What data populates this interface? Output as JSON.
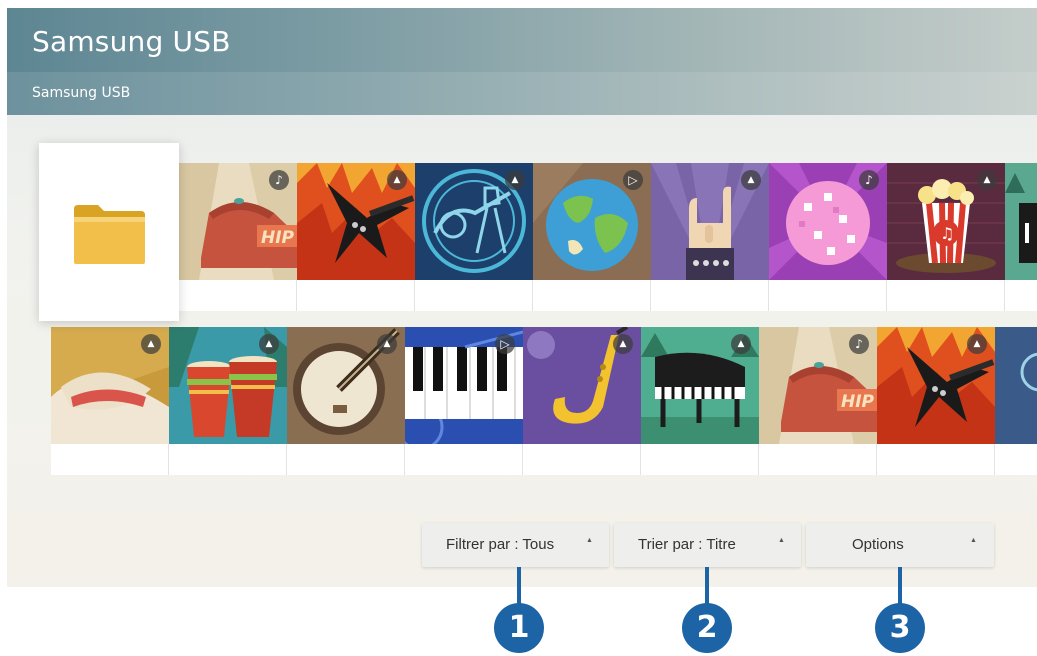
{
  "header": {
    "title": "Samsung USB",
    "breadcrumb": "Samsung USB"
  },
  "folder_tile": {
    "icon": "folder-icon"
  },
  "content_rows": [
    [
      {
        "art": "hip-hop-cap",
        "type": "music"
      },
      {
        "art": "electric-guitar-fire",
        "type": "photo"
      },
      {
        "art": "guitarist-circle",
        "type": "photo"
      },
      {
        "art": "globe",
        "type": "video"
      },
      {
        "art": "rock-hand",
        "type": "photo"
      },
      {
        "art": "disco-ball",
        "type": "music"
      },
      {
        "art": "popcorn",
        "type": "photo"
      },
      {
        "art": "piano-partial",
        "type": "none"
      }
    ],
    [
      {
        "art": "cowboy-hat",
        "type": "photo"
      },
      {
        "art": "bongo-drums",
        "type": "photo"
      },
      {
        "art": "banjo",
        "type": "photo"
      },
      {
        "art": "piano-keys",
        "type": "video"
      },
      {
        "art": "saxophone",
        "type": "photo"
      },
      {
        "art": "grand-piano",
        "type": "photo"
      },
      {
        "art": "hip-hop-cap",
        "type": "music"
      },
      {
        "art": "electric-guitar-fire",
        "type": "photo"
      },
      {
        "art": "partial-circle",
        "type": "none"
      }
    ]
  ],
  "type_badges": {
    "music": "♪",
    "photo": "▲",
    "video": "▷"
  },
  "controls": {
    "filter": {
      "label": "Filtrer par : Tous",
      "caret": "▲"
    },
    "sort": {
      "label": "Trier par : Titre",
      "caret": "▲"
    },
    "options": {
      "label": "Options",
      "caret": "▲"
    }
  },
  "callouts": [
    "1",
    "2",
    "3"
  ],
  "colors": {
    "accent": "#1d64a6",
    "header": "#6b909b"
  }
}
